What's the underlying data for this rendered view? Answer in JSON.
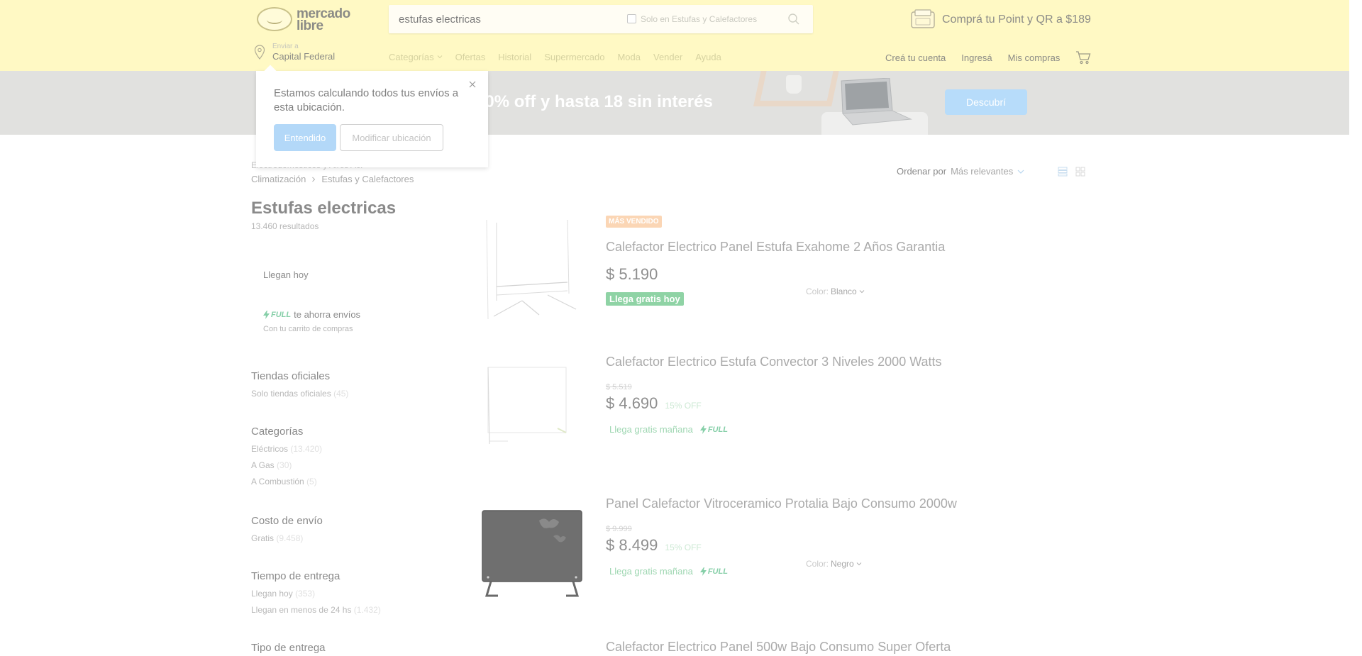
{
  "header": {
    "logo_line1": "mercado",
    "logo_line2": "libre",
    "search_value": "estufas electricas",
    "search_checkbox_label": "Solo en Estufas y Calefactores",
    "promo_text": "Comprá tu Point y QR a $189",
    "ship_label": "Enviar a",
    "ship_city": "Capital Federal",
    "nav": [
      "Categorías",
      "Ofertas",
      "Historial",
      "Supermercado",
      "Moda",
      "Vender",
      "Ayuda"
    ],
    "user_links": [
      "Creá tu cuenta",
      "Ingresá",
      "Mis compras"
    ]
  },
  "banner": {
    "text": "a 40% off y hasta 18 sin interés",
    "button": "Descubrí"
  },
  "popup": {
    "message": "Estamos calculando todos tus envíos a esta ubicación.",
    "ok_label": "Entendido",
    "modify_label": "Modificar ubicación"
  },
  "breadcrumb": {
    "row1": "Electrodomésticos y Aires Ac.",
    "items": [
      "Climatización",
      "Estufas y Calefactores"
    ]
  },
  "search_title": "Estufas electricas",
  "result_count": "13.460 resultados",
  "delivery_card": {
    "llegan_hoy": "Llegan hoy",
    "full_label": "FULL",
    "full_text": "te ahorra envíos",
    "full_sub": "Con tu carrito de compras"
  },
  "filters": [
    {
      "title": "Tiendas oficiales",
      "options": [
        {
          "label": "Solo tiendas oficiales",
          "count": "(45)"
        }
      ]
    },
    {
      "title": "Categorías",
      "options": [
        {
          "label": "Eléctricos",
          "count": "(13.420)"
        },
        {
          "label": "A Gas",
          "count": "(30)"
        },
        {
          "label": "A Combustión",
          "count": "(5)"
        }
      ]
    },
    {
      "title": "Costo de envío",
      "options": [
        {
          "label": "Gratis",
          "count": "(9.458)"
        }
      ]
    },
    {
      "title": "Tiempo de entrega",
      "options": [
        {
          "label": "Llegan hoy",
          "count": "(353)"
        },
        {
          "label": "Llegan en menos de 24 hs",
          "count": "(1.432)"
        }
      ]
    },
    {
      "title": "Tipo de entrega",
      "options": []
    }
  ],
  "sort": {
    "label": "Ordenar por",
    "value": "Más relevantes"
  },
  "results": [
    {
      "badge": "MÁS VENDIDO",
      "title": "Calefactor Electrico Panel Estufa Exahome 2 Años Garantia",
      "old_price": "",
      "price": "$ 5.190",
      "off": "",
      "shipping": "Llega gratis hoy",
      "full": "",
      "color_label": "Color:",
      "color_value": "Blanco"
    },
    {
      "badge": "",
      "title": "Calefactor Electrico Estufa Convector 3 Niveles 2000 Watts",
      "old_price": "$ 5.519",
      "price": "$ 4.690",
      "off": "15% OFF",
      "shipping": "Llega gratis mañana",
      "full": "FULL",
      "color_label": "",
      "color_value": ""
    },
    {
      "badge": "",
      "title": "Panel Calefactor Vitroceramico Protalia Bajo Consumo 2000w",
      "old_price": "$ 9.999",
      "price": "$ 8.499",
      "off": "15% OFF",
      "shipping": "Llega gratis mañana",
      "full": "FULL",
      "color_label": "Color:",
      "color_value": "Negro"
    },
    {
      "badge": "",
      "title": "Calefactor Electrico Panel 500w Bajo Consumo Super Oferta",
      "old_price": "",
      "price": "",
      "off": "",
      "shipping": "",
      "full": "",
      "color_label": "",
      "color_value": ""
    }
  ],
  "colors": {
    "header_bg": "#fff9c4",
    "banner_bg": "#e1e1df",
    "accent_blue": "#b3d8f8",
    "ship_green": "#8fd3a5"
  }
}
